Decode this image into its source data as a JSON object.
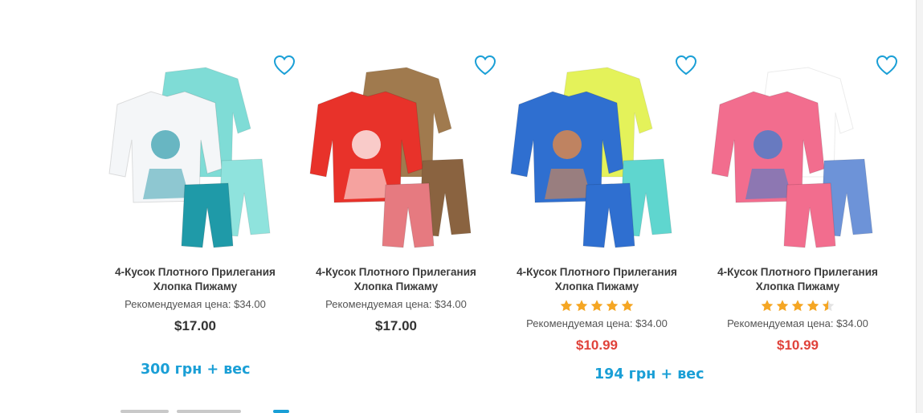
{
  "products": [
    {
      "title_line1": "4-Кусок Плотного Прилегания",
      "title_line2": "Хлопка Пижаму",
      "rating": null,
      "retail_label": "Рекомендуемая цена: $34.00",
      "price": "$17.00",
      "price_kind": "regular",
      "image_icon": "pajama-set-image",
      "colors": {
        "top1": "#f4f6f8",
        "top2": "#7fdcd6",
        "bottom1": "#1f9aa8",
        "bottom2": "#8fe3dd",
        "accent": "#3aa0b0"
      }
    },
    {
      "title_line1": "4-Кусок Плотного Прилегания",
      "title_line2": "Хлопка Пижаму",
      "rating": null,
      "retail_label": "Рекомендуемая цена: $34.00",
      "price": "$17.00",
      "price_kind": "regular",
      "image_icon": "pajama-set-image",
      "colors": {
        "top1": "#e8322a",
        "top2": "#a07a4e",
        "bottom1": "#e67a80",
        "bottom2": "#8a6340",
        "accent": "#ffffff"
      }
    },
    {
      "title_line1": "4-Кусок Плотного Прилегания",
      "title_line2": "Хлопка Пижаму",
      "rating": 5,
      "retail_label": "Рекомендуемая цена: $34.00",
      "price": "$10.99",
      "price_kind": "sale",
      "image_icon": "pajama-set-image",
      "colors": {
        "top1": "#2f6fd0",
        "top2": "#e4f25a",
        "bottom1": "#2f6fd0",
        "bottom2": "#5fd6cf",
        "accent": "#f08a3c"
      }
    },
    {
      "title_line1": "4-Кусок Плотного Прилегания",
      "title_line2": "Хлопка Пижаму",
      "rating": 4.5,
      "retail_label": "Рекомендуемая цена: $34.00",
      "price": "$10.99",
      "price_kind": "sale",
      "image_icon": "pajama-set-image",
      "colors": {
        "top1": "#f26d8e",
        "top2": "#ffffff",
        "bottom1": "#f26d8e",
        "bottom2": "#6d93d8",
        "accent": "#3a7fd0"
      }
    }
  ],
  "annotations": [
    {
      "text": "300 грн + вес"
    },
    {
      "text": "194 грн + вес"
    }
  ],
  "icons": {
    "favorite": "heart-outline-icon",
    "star": "star-icon"
  },
  "theme": {
    "accent": "#1a9fd6",
    "sale": "#e0423a",
    "star": "#f5a623"
  }
}
